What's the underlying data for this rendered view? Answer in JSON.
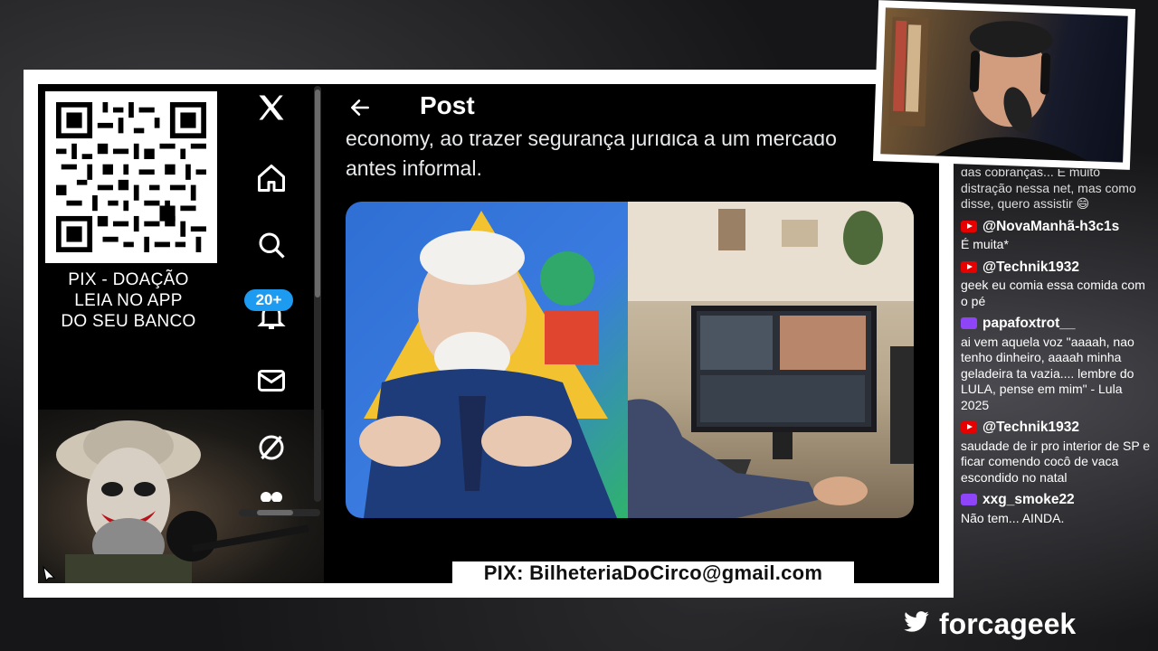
{
  "stream": {
    "pix_qr_caption": [
      "PIX - DOAÇÃO",
      "LEIA NO APP",
      "DO SEU BANCO"
    ],
    "pix_email": "PIX: BilheteriaDoCirco@gmail.com"
  },
  "x_sidebar": {
    "items": [
      {
        "icon": "x-logo-icon"
      },
      {
        "icon": "home-icon"
      },
      {
        "icon": "search-icon"
      },
      {
        "icon": "notifications-bell-icon",
        "badge": "20+"
      },
      {
        "icon": "messages-mail-icon"
      },
      {
        "icon": "grok-slash-icon"
      }
    ]
  },
  "post": {
    "header_title": "Post",
    "text_partial": "economy, ao trazer segurança jurídica a um mercado",
    "text_line": "antes informal."
  },
  "chat": {
    "top_partial": "das cobranças... É muito distração nessa net, mas como disse, quero assistir 😄",
    "messages": [
      {
        "platform": "youtube",
        "user": "@NovaManhã-h3c1s",
        "text": "É muita*"
      },
      {
        "platform": "youtube",
        "user": "@Technik1932",
        "text": "geek eu comia essa comida com o pé"
      },
      {
        "platform": "twitch",
        "user": "papafoxtrot__",
        "text": "ai vem aquela voz \"aaaah, nao tenho dinheiro, aaaah minha geladeira ta vazia.... lembre do LULA, pense em mim\" - Lula 2025"
      },
      {
        "platform": "youtube",
        "user": "@Technik1932",
        "text": "saudade de ir pro interior de SP e ficar comendo cocô de vaca escondido no natal"
      },
      {
        "platform": "twitch",
        "user": "xxg_smoke22",
        "text": "Não tem... AINDA."
      }
    ]
  },
  "brand": {
    "name": "forcageek",
    "icon": "twitter-bird-icon"
  },
  "colors": {
    "x_blue": "#1d9bf0",
    "youtube_red": "#e60000",
    "twitch_purple": "#8d45f7"
  }
}
